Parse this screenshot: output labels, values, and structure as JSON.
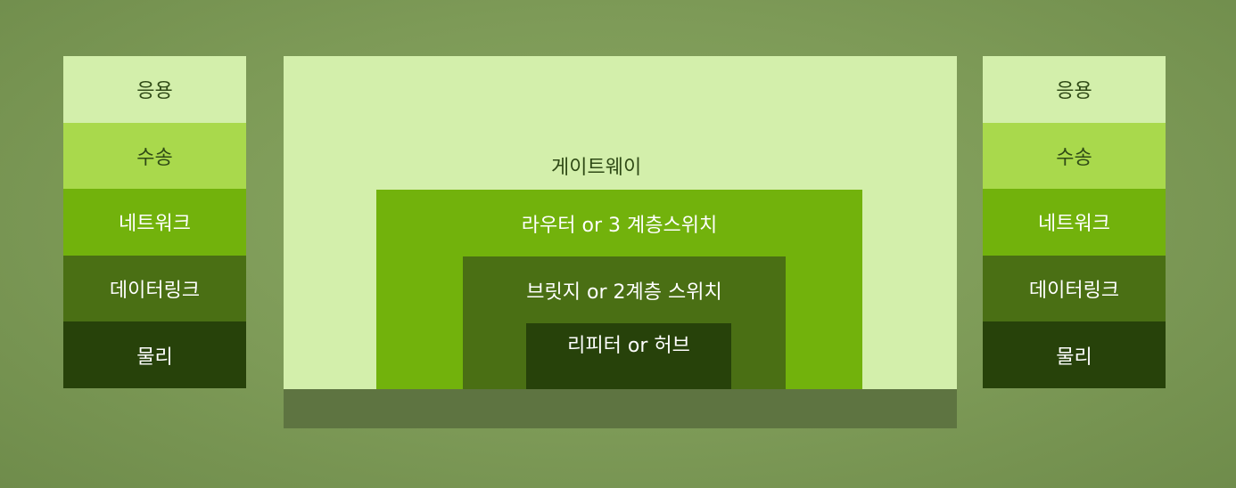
{
  "left_stack": {
    "layers": [
      "응용",
      "수송",
      "네트워크",
      "데이터링크",
      "물리"
    ]
  },
  "right_stack": {
    "layers": [
      "응용",
      "수송",
      "네트워크",
      "데이터링크",
      "물리"
    ]
  },
  "device": {
    "gateway": "게이트웨이",
    "router": "라우터 or 3 계층스위치",
    "bridge": "브릿지 or 2계층 스위치",
    "hub": "리피터 or 허브"
  },
  "colors": {
    "background": "#7d9a57",
    "application": "#d3efab",
    "transport": "#a9d94c",
    "network": "#72b20c",
    "datalink": "#4a6f14",
    "physical": "#27420a"
  }
}
